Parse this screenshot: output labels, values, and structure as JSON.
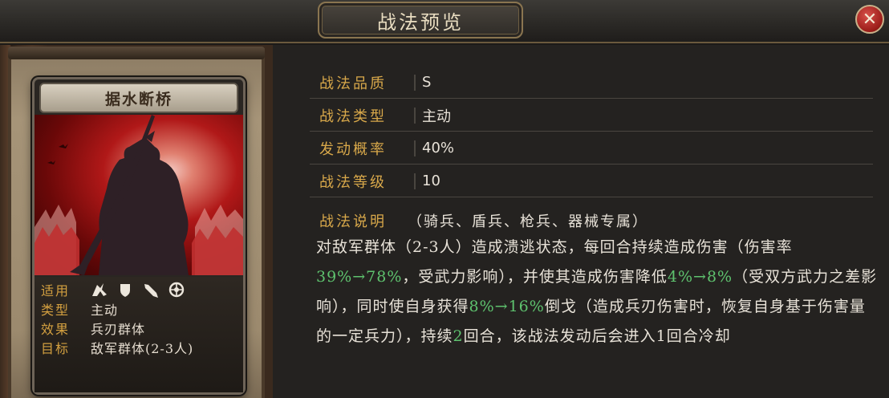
{
  "header": {
    "title": "战法预览",
    "close_glyph": "✕"
  },
  "card": {
    "name": "据水断桥",
    "art_icon": "silhouette-general-icon",
    "rows": [
      {
        "label": "适用",
        "icons": [
          "cavalry-icon",
          "shield-icon",
          "spear-icon",
          "siege-icon"
        ]
      },
      {
        "label": "类型",
        "value": "主动"
      },
      {
        "label": "效果",
        "value": "兵刃群体"
      },
      {
        "label": "目标",
        "value": "敌军群体(2-3人)"
      }
    ]
  },
  "properties": [
    {
      "label": "战法品质",
      "value": "S"
    },
    {
      "label": "战法类型",
      "value": "主动"
    },
    {
      "label": "发动概率",
      "value": "40%"
    },
    {
      "label": "战法等级",
      "value": "10"
    }
  ],
  "description": {
    "label": "战法说明",
    "tag": "（骑兵、盾兵、枪兵、器械专属）",
    "segments": [
      {
        "text": "对敌军群体（2-3人）造成溃逃状态，每回合持续造成伤害（伤害率",
        "hl": false
      },
      {
        "text": "39%→78%",
        "hl": true
      },
      {
        "text": "，受武力影响），并使其造成伤害降低",
        "hl": false
      },
      {
        "text": "4%→8%",
        "hl": true
      },
      {
        "text": "（受双方武力之差影响），同时使自身获得",
        "hl": false
      },
      {
        "text": "8%→16%",
        "hl": true
      },
      {
        "text": "倒戈（造成兵刃伤害时，恢复自身基于伤害量的一定兵力），持续",
        "hl": false
      },
      {
        "text": "2",
        "hl": true
      },
      {
        "text": "回合，该战法发动后会进入1回合冷却",
        "hl": false
      }
    ]
  },
  "colors": {
    "label_gold": "#d8a84a",
    "highlight_green": "#5ec26e",
    "text_light": "#e8e2d8"
  }
}
